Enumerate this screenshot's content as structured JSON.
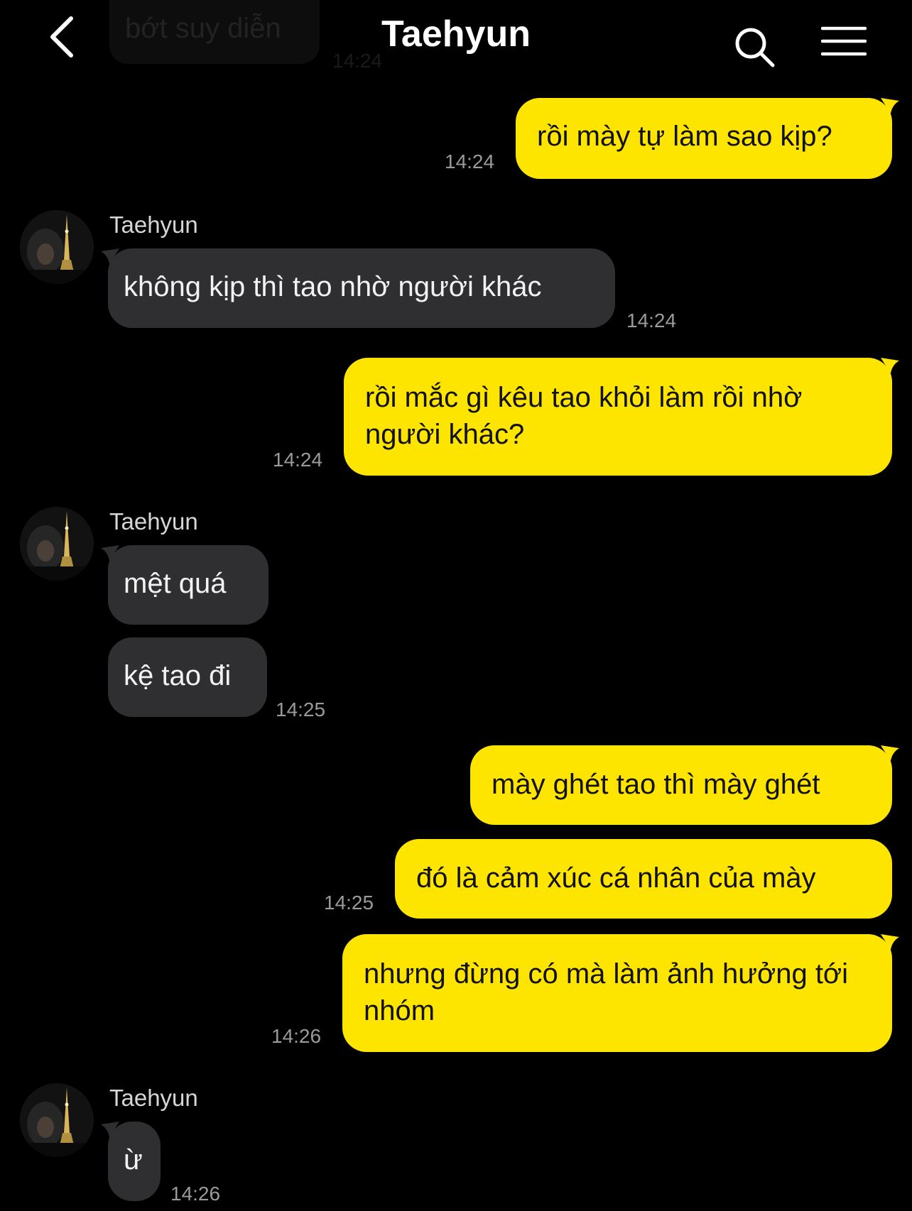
{
  "header": {
    "title": "Taehyun"
  },
  "icons": {
    "back": "chevron-left-icon",
    "search": "search-icon",
    "menu": "hamburger-menu-icon"
  },
  "colors": {
    "my_bubble": "#fee500",
    "their_bubble": "#2f2f31",
    "background": "#000000",
    "timestamp": "#9a9a9a"
  },
  "previous": {
    "text": "bớt suy diễn",
    "time": "14:24"
  },
  "messages": [
    {
      "from": "me",
      "text": "rồi mày tự làm sao kịp?",
      "time": "14:24"
    },
    {
      "from": "them",
      "sender": "Taehyun",
      "text": "không kịp thì tao nhờ người khác",
      "time": "14:24"
    },
    {
      "from": "me",
      "text": "rồi mắc gì kêu tao khỏi làm rồi nhờ người khác?",
      "time": "14:24"
    },
    {
      "from": "them",
      "sender": "Taehyun",
      "text": "mệt quá"
    },
    {
      "from": "them",
      "text": "kệ tao đi",
      "time": "14:25"
    },
    {
      "from": "me",
      "text": "mày ghét tao thì mày ghét"
    },
    {
      "from": "me",
      "text": "đó là cảm xúc cá nhân của mày",
      "time": "14:25"
    },
    {
      "from": "me",
      "text": "nhưng đừng có mà làm ảnh hưởng tới nhóm",
      "time": "14:26"
    },
    {
      "from": "them",
      "sender": "Taehyun",
      "text": "ừ",
      "time": "14:26"
    }
  ]
}
